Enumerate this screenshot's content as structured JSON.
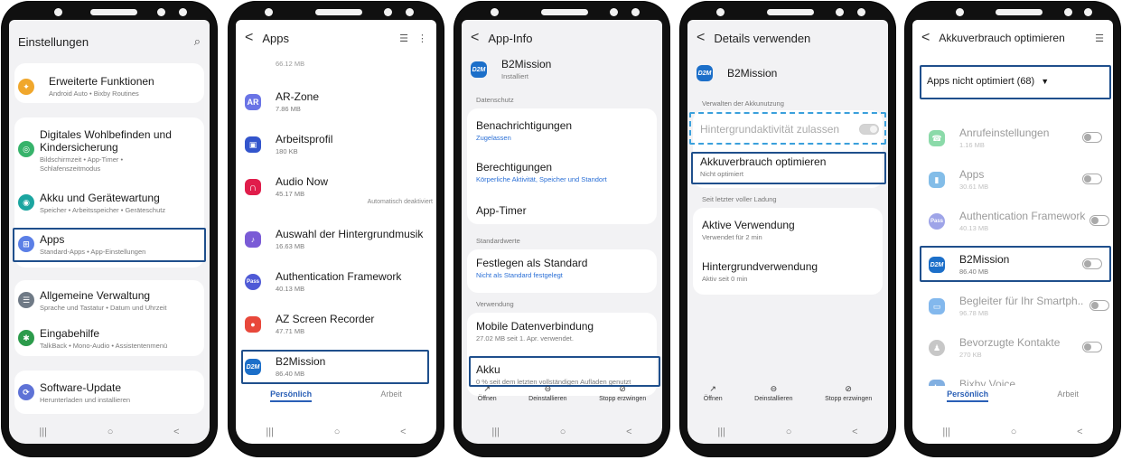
{
  "colors": {
    "accent": "#2a5fb6",
    "highlight": "#1f4f8c",
    "dashed": "#3aa0dc"
  },
  "common": {
    "tab_personal": "Persönlich",
    "tab_work": "Arbeit",
    "nav_recent": "|||",
    "nav_home": "○",
    "nav_back": "<"
  },
  "s1": {
    "title": "Einstellungen",
    "items": [
      {
        "title": "Erweiterte Funktionen",
        "sub": "Android Auto • Bixby Routines"
      },
      {
        "title": "Digitales Wohlbefinden und Kindersicherung",
        "sub": "Bildschirmzeit • App-Timer • Schlafenszeitmodus"
      },
      {
        "title": "Akku und Gerätewartung",
        "sub": "Speicher • Arbeitsspeicher • Geräteschutz"
      },
      {
        "title": "Apps",
        "sub": "Standard-Apps • App-Einstellungen"
      },
      {
        "title": "Allgemeine Verwaltung",
        "sub": "Sprache und Tastatur • Datum und Uhrzeit"
      },
      {
        "title": "Eingabehilfe",
        "sub": "TalkBack • Mono-Audio • Assistentenmenü"
      },
      {
        "title": "Software-Update",
        "sub": "Herunterladen und installieren"
      }
    ]
  },
  "s2": {
    "title": "Apps",
    "top_size": "66.12 MB",
    "items": [
      {
        "title": "AR-Zone",
        "sub": "7.86 MB",
        "icon": "AR"
      },
      {
        "title": "Arbeitsprofil",
        "sub": "180 KB",
        "icon": "▣"
      },
      {
        "title": "Audio Now",
        "sub": "45.17 MB",
        "icon": "∩",
        "note": "Automatisch deaktiviert"
      },
      {
        "title": "Auswahl der Hintergrundmusik",
        "sub": "16.63 MB",
        "icon": "♪"
      },
      {
        "title": "Authentication Framework",
        "sub": "40.13 MB",
        "icon": "Pass"
      },
      {
        "title": "AZ Screen Recorder",
        "sub": "47.71 MB",
        "icon": "●"
      },
      {
        "title": "B2Mission",
        "sub": "86.40 MB",
        "icon": "D2M"
      }
    ]
  },
  "s3": {
    "title": "App-Info",
    "app_name": "B2Mission",
    "app_status": "Installiert",
    "app_icon": "D2M",
    "section_privacy": "Datenschutz",
    "section_defaults": "Standardwerte",
    "section_usage": "Verwendung",
    "items": [
      {
        "title": "Benachrichtigungen",
        "sub": "Zugelassen"
      },
      {
        "title": "Berechtigungen",
        "sub": "Körperliche Aktivität, Speicher und Standort"
      },
      {
        "title": "App-Timer",
        "sub": ""
      },
      {
        "title": "Festlegen als Standard",
        "sub": "Nicht als Standard festgelegt"
      },
      {
        "title": "Mobile Datenverbindung",
        "sub": "27.02 MB seit 1. Apr. verwendet."
      },
      {
        "title": "Akku",
        "sub": "0 % seit dem letzten vollständigen Aufladen genutzt"
      }
    ],
    "actions": [
      "Öffnen",
      "Deinstallieren",
      "Stopp erzwingen"
    ]
  },
  "s4": {
    "title": "Details verwenden",
    "app_name": "B2Mission",
    "app_icon": "D2M",
    "section_manage": "Verwalten der Akkunutzung",
    "section_since": "Seit letzter voller Ladung",
    "bg_allow": "Hintergrundaktivität zulassen",
    "optimize_title": "Akkuverbrauch optimieren",
    "optimize_sub": "Nicht optimiert",
    "active_title": "Aktive Verwendung",
    "active_sub": "Verwendet für 2 min",
    "bg_title": "Hintergrundverwendung",
    "bg_sub": "Aktiv seit 0 min",
    "actions": [
      "Öffnen",
      "Deinstallieren",
      "Stopp erzwingen"
    ]
  },
  "s5": {
    "title": "Akkuverbrauch optimieren",
    "filter": "Apps nicht optimiert (68)",
    "items": [
      {
        "title": "Anrufeinstellungen",
        "sub": "1.16 MB",
        "icon": "☎",
        "dim": true
      },
      {
        "title": "Apps",
        "sub": "30.61 MB",
        "icon": "▮",
        "dim": true
      },
      {
        "title": "Authentication Framework",
        "sub": "40.13 MB",
        "icon": "Pass",
        "dim": true
      },
      {
        "title": "B2Mission",
        "sub": "86.40 MB",
        "icon": "D2M",
        "dim": false
      },
      {
        "title": "Begleiter für Ihr Smartph..",
        "sub": "96.78 MB",
        "icon": "▭",
        "dim": true
      },
      {
        "title": "Bevorzugte Kontakte",
        "sub": "270 KB",
        "icon": "♟",
        "dim": true
      },
      {
        "title": "Bixby Voice",
        "sub": "",
        "icon": "b",
        "dim": true
      }
    ]
  }
}
